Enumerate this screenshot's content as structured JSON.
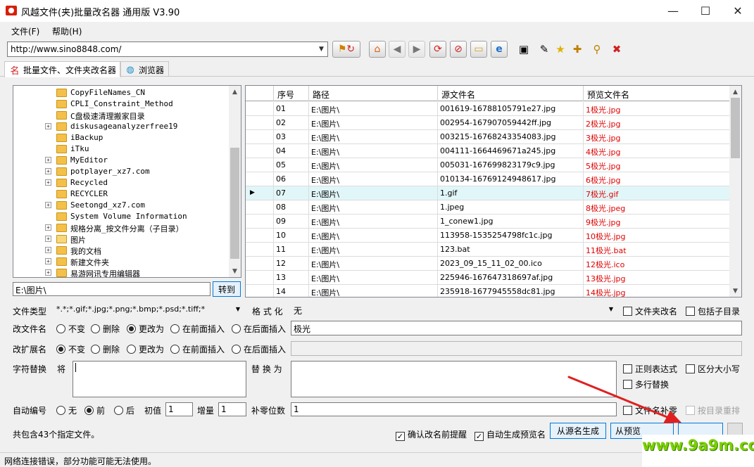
{
  "window": {
    "title": "风越文件(夹)批量改名器 通用版 V3.90",
    "minimize": "—",
    "maximize": "☐",
    "close": "✕"
  },
  "menu": [
    "文件(F)",
    "帮助(H)"
  ],
  "address": {
    "url": "http://www.sino8848.com/"
  },
  "tabs": [
    {
      "label": "批量文件、文件夹改名器",
      "icon": "rename-icon",
      "active": true
    },
    {
      "label": "浏览器",
      "icon": "globe-icon",
      "active": false
    }
  ],
  "tree": {
    "items": [
      {
        "label": "CopyFileNames_CN",
        "expandable": false
      },
      {
        "label": "CPLI_Constraint_Method",
        "expandable": false
      },
      {
        "label": "C盘极速清理搬家目录",
        "expandable": false
      },
      {
        "label": "diskusageanalyzerfree19",
        "expandable": true
      },
      {
        "label": "iBackup",
        "expandable": false
      },
      {
        "label": "iTku",
        "expandable": false
      },
      {
        "label": "MyEditor",
        "expandable": true
      },
      {
        "label": "potplayer_xz7.com",
        "expandable": true
      },
      {
        "label": "Recycled",
        "expandable": true
      },
      {
        "label": "RECYCLER",
        "expandable": false
      },
      {
        "label": "Seetongd_xz7.com",
        "expandable": true
      },
      {
        "label": "System Volume Information",
        "expandable": false
      },
      {
        "label": "规格分离_按文件分离（子目录）",
        "expandable": true
      },
      {
        "label": "图片",
        "expandable": true,
        "open": true
      },
      {
        "label": "我的文档",
        "expandable": true
      },
      {
        "label": "新建文件夹",
        "expandable": true
      },
      {
        "label": "易游网讯专用编辑器",
        "expandable": true
      }
    ]
  },
  "path_input": "E:\\图片\\",
  "goto_label": "转到",
  "grid": {
    "headers": [
      "序号",
      "路径",
      "源文件名",
      "预览文件名"
    ],
    "rows": [
      [
        "01",
        "E:\\图片\\",
        "001619-16788105791e27.jpg",
        "1极光.jpg"
      ],
      [
        "02",
        "E:\\图片\\",
        "002954-167907059442ff.jpg",
        "2极光.jpg"
      ],
      [
        "03",
        "E:\\图片\\",
        "003215-16768243354083.jpg",
        "3极光.jpg"
      ],
      [
        "04",
        "E:\\图片\\",
        "004111-1664469671a245.jpg",
        "4极光.jpg"
      ],
      [
        "05",
        "E:\\图片\\",
        "005031-167699823179c9.jpg",
        "5极光.jpg"
      ],
      [
        "06",
        "E:\\图片\\",
        "010134-16769124948617.jpg",
        "6极光.jpg"
      ],
      [
        "07",
        "E:\\图片\\",
        "1.gif",
        "7极光.gif"
      ],
      [
        "08",
        "E:\\图片\\",
        "1.jpeg",
        "8极光.jpeg"
      ],
      [
        "09",
        "E:\\图片\\",
        "1_conew1.jpg",
        "9极光.jpg"
      ],
      [
        "10",
        "E:\\图片\\",
        "113958-1535254798fc1c.jpg",
        "10极光.jpg"
      ],
      [
        "11",
        "E:\\图片\\",
        "123.bat",
        "11极光.bat"
      ],
      [
        "12",
        "E:\\图片\\",
        "2023_09_15_11_02_00.ico",
        "12极光.ico"
      ],
      [
        "13",
        "E:\\图片\\",
        "225946-167647318697af.jpg",
        "13极光.jpg"
      ],
      [
        "14",
        "E:\\图片\\",
        "235918-1677945558dc81.jpg",
        "14极光.jpg"
      ]
    ],
    "selected_index": 6,
    "row_pointer": "▶"
  },
  "form": {
    "file_type_label": "文件类型",
    "file_type_value": "*.*;*.gif;*.jpg;*.png;*.bmp;*.psd;*.tiff;*",
    "format_label": "格 式 化",
    "format_value": "无",
    "folder_rename_label": "文件夹改名",
    "include_subdir_label": "包括子目录",
    "rename_label": "改文件名",
    "rename_options": [
      "不变",
      "删除",
      "更改为",
      "在前面插入",
      "在后面插入"
    ],
    "rename_selected": 2,
    "rename_value": "极光",
    "ext_label": "改扩展名",
    "ext_options": [
      "不变",
      "删除",
      "更改为",
      "在前面插入",
      "在后面插入"
    ],
    "ext_selected": 0,
    "replace_label": "字符替换",
    "replace_from_label": "将",
    "replace_to_label": "替 换 为",
    "regex_label": "正则表达式",
    "case_label": "区分大小写",
    "multiline_label": "多行替换",
    "autonum_label": "自动编号",
    "autonum_options": [
      "无",
      "前",
      "后"
    ],
    "autonum_selected": 1,
    "init_label": "初值",
    "init_value": "1",
    "step_label": "增量",
    "step_value": "1",
    "pad_label": "补零位数",
    "pad_value": "1",
    "filename_pad_label": "文件名补零",
    "dir_reorder_label": "按目录重排",
    "total_text": "共包含43个指定文件。",
    "confirm_label": "确认改名前提醒",
    "autopreview_label": "自动生成预览名",
    "from_source_btn": "从源名生成",
    "from_preview_btn": "从预览"
  },
  "status": "网络连接错误，部分功能可能无法使用。",
  "watermark": "www.9a9m.com",
  "colors": {
    "preview_red": "#e00000",
    "selected_row": "#e1f6f8",
    "button_blue": "#0078d7",
    "arrow_red": "#e02020",
    "watermark_green": "#7ad100"
  }
}
